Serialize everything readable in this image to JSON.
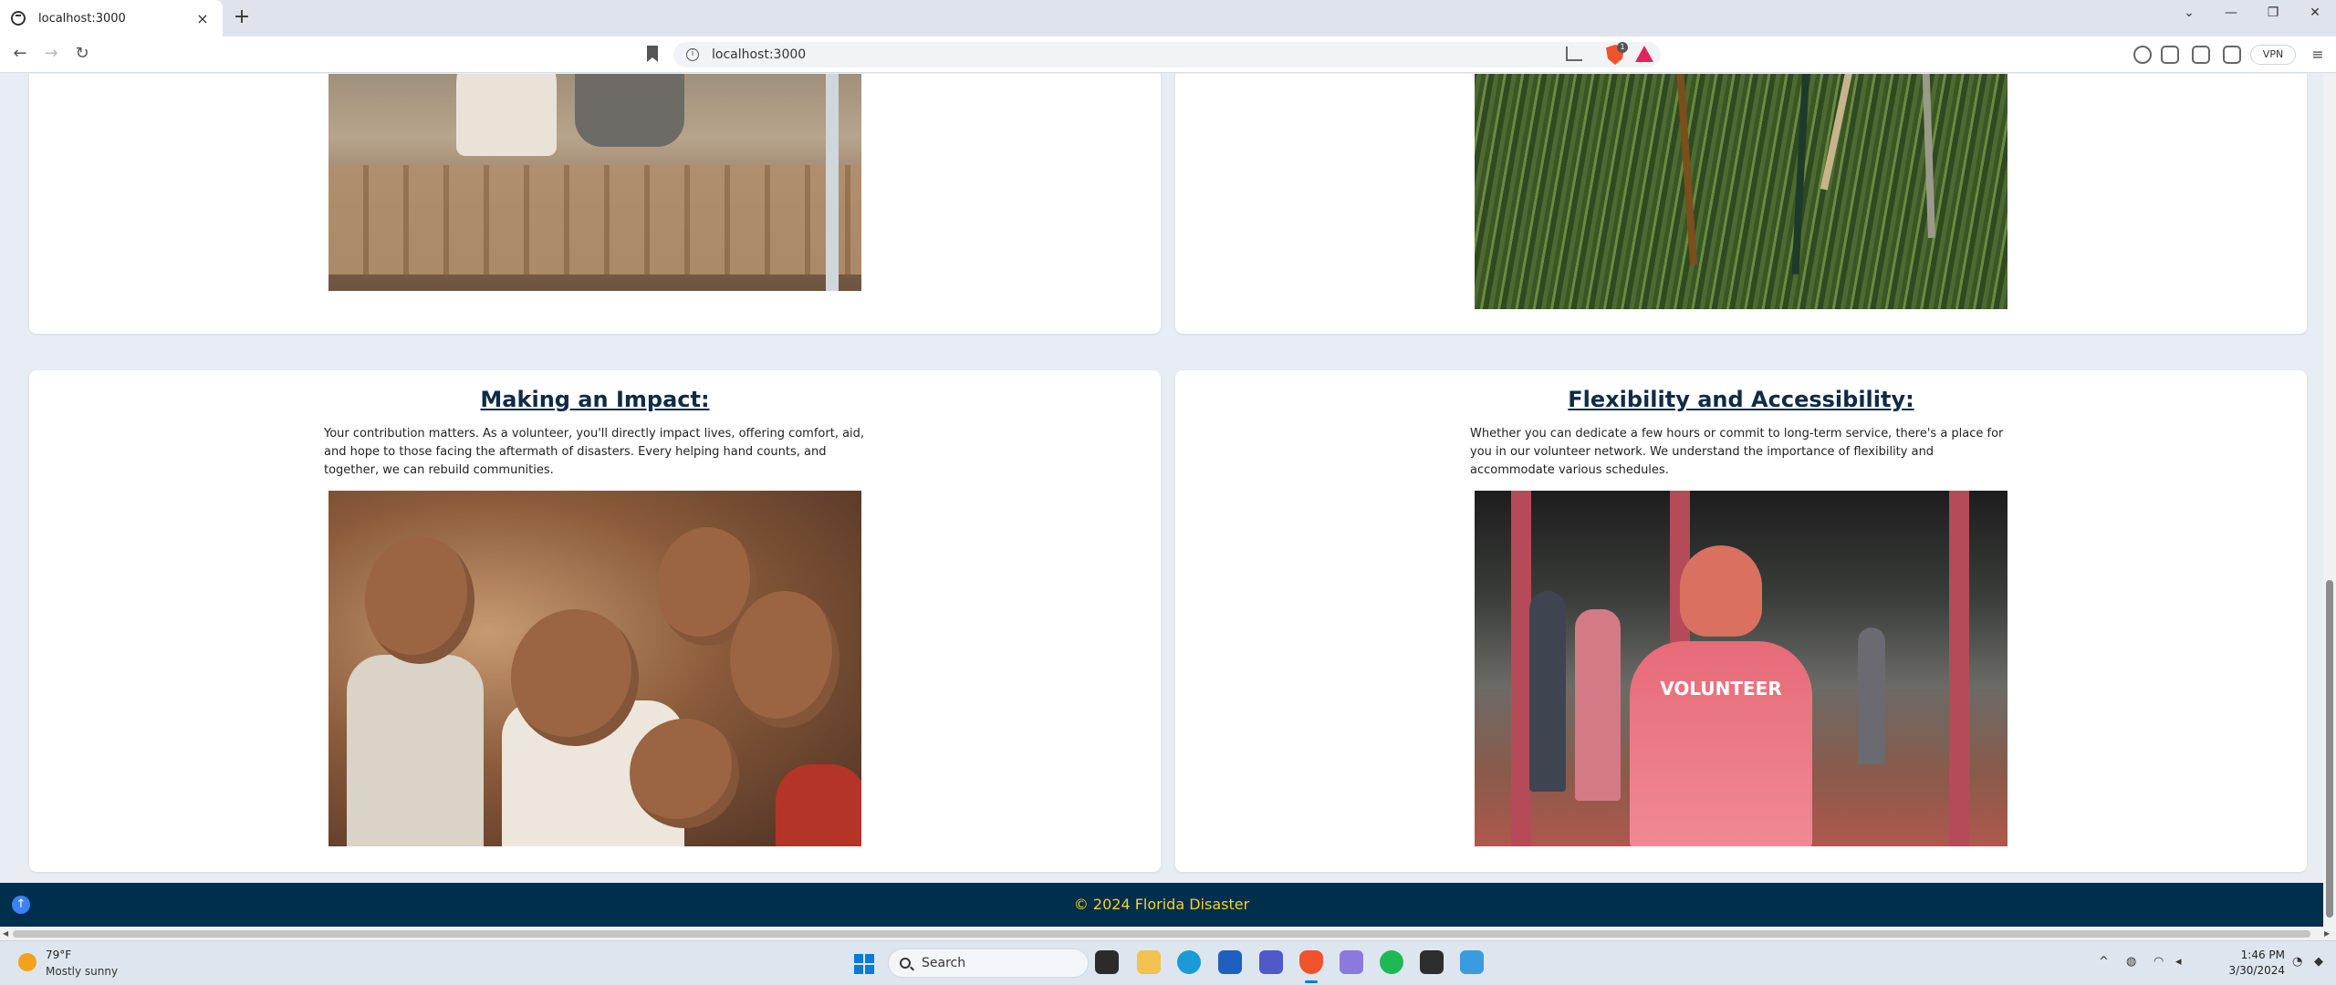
{
  "browser": {
    "tab_title": "localhost:3000",
    "tab_close": "×",
    "new_tab": "+",
    "url": "localhost:3000",
    "shield_count": "1",
    "vpn_label": "VPN",
    "window_controls": {
      "chevron": "⌄",
      "minimize": "—",
      "restore": "❐",
      "close": "✕"
    },
    "nav": {
      "back": "←",
      "forward": "→",
      "reload": "↻"
    },
    "menu": "≡"
  },
  "cards": [
    {
      "title": "",
      "image_alt": "Volunteers packing paper bags at a food distribution table"
    },
    {
      "title": "",
      "image_alt": "Garden tools lying in the grass"
    },
    {
      "title": "Making an Impact:",
      "body": "Your contribution matters. As a volunteer, you'll directly impact lives, offering comfort, aid, and hope to those facing the aftermath of disasters. Every helping hand counts, and together, we can rebuild communities.",
      "image_alt": "Smiling children making peace signs"
    },
    {
      "title": "Flexibility and Accessibility:",
      "body": "Whether you can dedicate a few hours or commit to long-term service, there's a place for you in our volunteer network. We understand the importance of flexibility and accommodate various schedules.",
      "image_alt": "Volunteer in a red cap and pink volunteer shirt",
      "shirt_text": "VOLUNTEER"
    }
  ],
  "footer": {
    "text": "© 2024 Florida Disaster",
    "scroll_top": "↑"
  },
  "taskbar": {
    "weather_temp": "79°F",
    "weather_desc": "Mostly sunny",
    "search_label": "Search",
    "clock_time": "1:46 PM",
    "clock_date": "3/30/2024",
    "tray_chevron": "^"
  },
  "colors": {
    "footer_bg": "#002e4d",
    "footer_text": "#f5d22e",
    "heading": "#0f2b46",
    "page_bg": "#e8edf4"
  }
}
